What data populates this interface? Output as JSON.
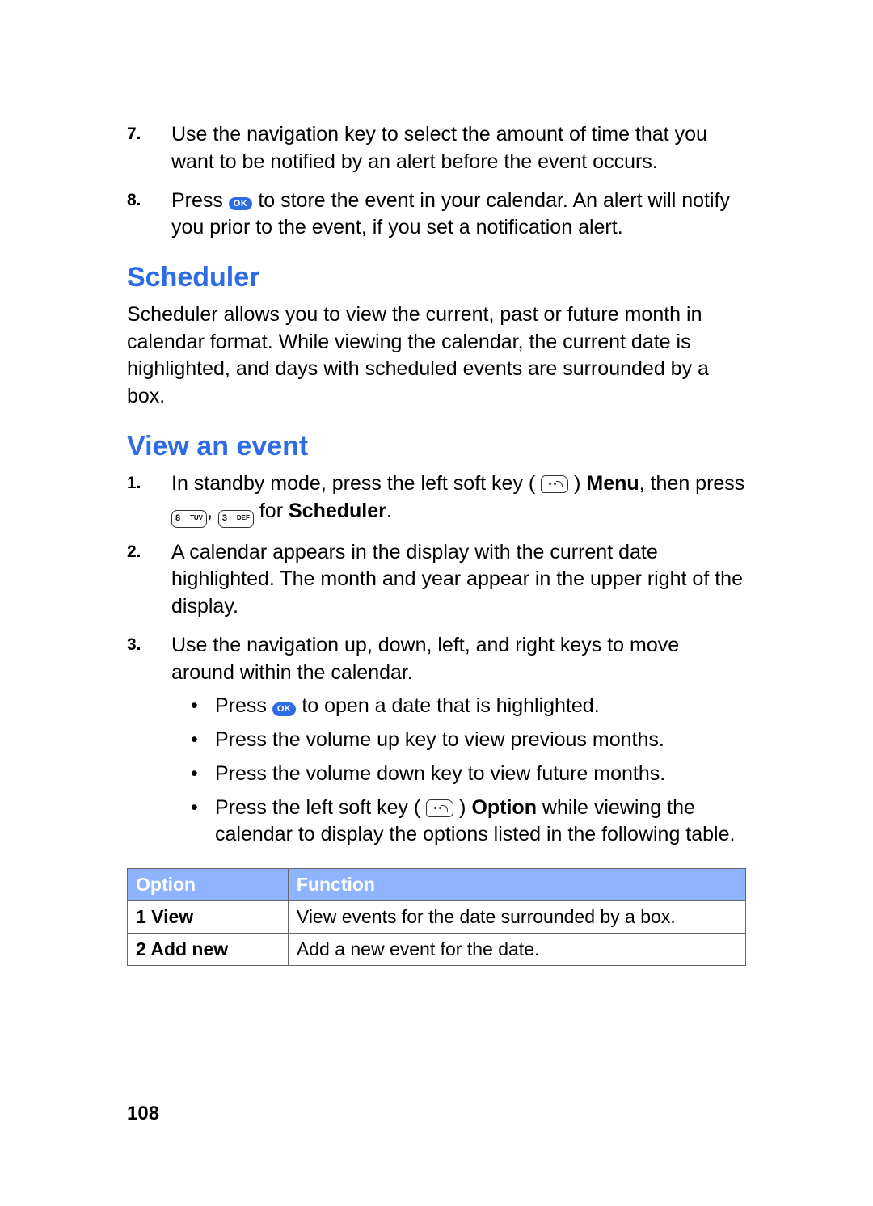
{
  "steps_continued": [
    {
      "num": "7.",
      "text": "Use the navigation key to select the amount of time that you want to be notified by an alert before the event occurs."
    },
    {
      "num": "8.",
      "pre": "Press ",
      "ok": "OK",
      "post": " to store the event in your calendar. An alert will notify you prior to the event, if you set a notification alert."
    }
  ],
  "scheduler": {
    "heading": "Scheduler",
    "intro": "Scheduler allows you to view the current, past or future month in calendar format. While viewing the calendar, the current date is highlighted, and days with scheduled events are surrounded by a box."
  },
  "view_event": {
    "heading": "View an event",
    "steps": [
      {
        "num": "1.",
        "pre": "In standby mode, press the left soft key ( ",
        "menu_bold": "Menu",
        "mid": ", then press ",
        "key8": "8",
        "key8_sup": "TUV",
        "comma": ", ",
        "key3": "3",
        "key3_sup": "DEF",
        "post_for": " for ",
        "scheduler_bold": "Scheduler",
        "end": "."
      },
      {
        "num": "2.",
        "text": "A calendar appears in the display with the current date highlighted. The month and year appear in the upper right of the display."
      },
      {
        "num": "3.",
        "text": "Use the navigation up, down, left, and right keys to move around within the calendar."
      }
    ],
    "sub": [
      {
        "pre": "Press ",
        "ok": "OK",
        "post": " to open a date that is highlighted."
      },
      {
        "text": "Press the volume up key to view previous months."
      },
      {
        "text": "Press the volume down key to view future months."
      },
      {
        "pre": "Press the left soft key ( ",
        "option_bold": "Option",
        "post": " while viewing the calendar to display the options listed in the following table."
      }
    ]
  },
  "table": {
    "headers": [
      "Option",
      "Function"
    ],
    "rows": [
      [
        "1 View",
        "View events for the date surrounded by a box."
      ],
      [
        "2 Add new",
        "Add a new event for the date."
      ]
    ]
  },
  "page_number": "108",
  "paren_close": " ) "
}
